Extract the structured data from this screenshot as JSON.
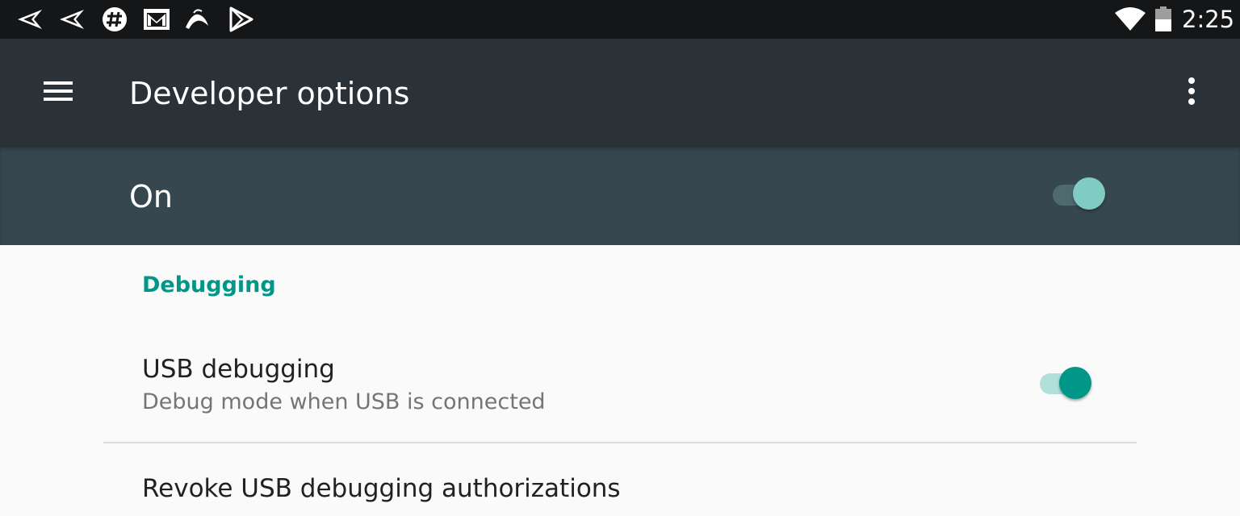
{
  "status_bar": {
    "notification_icons": [
      "send-icon",
      "send-icon",
      "slack-icon",
      "gmail-icon",
      "bird-icon",
      "play-store-icon"
    ],
    "status_icons": [
      "wifi-icon",
      "battery-icon"
    ],
    "clock": "2:25"
  },
  "app_bar": {
    "title": "Developer options",
    "nav_icon": "menu-icon",
    "overflow_icon": "more-vert-icon"
  },
  "master_switch": {
    "label": "On",
    "checked": true,
    "colors": {
      "bar": "#37474f",
      "thumb": "#80cbc4"
    }
  },
  "content": {
    "section_header": "Debugging",
    "usb_debugging": {
      "title": "USB debugging",
      "summary": "Debug mode when USB is connected",
      "checked": true
    },
    "revoke": {
      "title": "Revoke USB debugging authorizations"
    }
  },
  "colors": {
    "accent": "#009688",
    "status_bar": "#141618",
    "app_bar": "#2a3137",
    "background": "#fafafa"
  }
}
